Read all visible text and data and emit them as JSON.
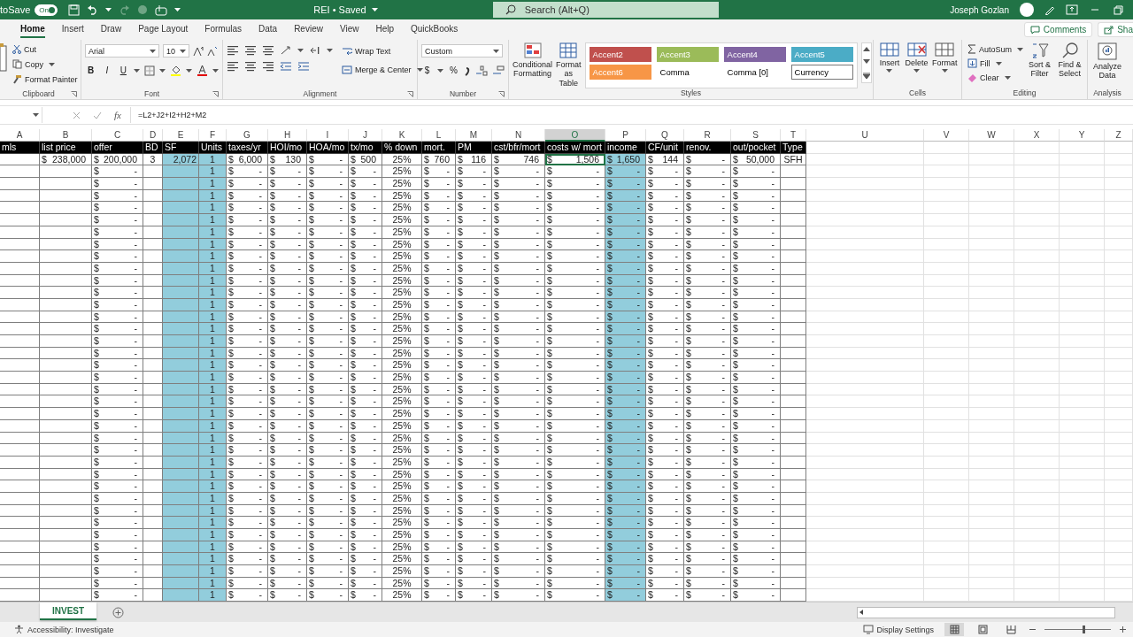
{
  "title_bar": {
    "autosave": "toSave",
    "autosave_toggle": {
      "label": "On",
      "on": true
    },
    "title": "REI • Saved",
    "search": {
      "placeholder": "Search (Alt+Q)"
    },
    "user": "Joseph Gozlan"
  },
  "ribbon_tabs": [
    {
      "label": "Home",
      "selected": true
    },
    {
      "label": "Insert",
      "selected": false
    },
    {
      "label": "Draw",
      "selected": false
    },
    {
      "label": "Page Layout",
      "selected": false
    },
    {
      "label": "Formulas",
      "selected": false
    },
    {
      "label": "Data",
      "selected": false
    },
    {
      "label": "Review",
      "selected": false
    },
    {
      "label": "View",
      "selected": false
    },
    {
      "label": "Help",
      "selected": false
    },
    {
      "label": "QuickBooks",
      "selected": false
    }
  ],
  "comments": "Comments",
  "share": "Sha",
  "ribbon": {
    "clipboard": {
      "cut": "Cut",
      "copy": "Copy",
      "format_painter": "Format Painter",
      "label": "Clipboard"
    },
    "font": {
      "family": "Arial",
      "size": "10",
      "bold": "B",
      "italic": "I",
      "underline": "U",
      "label": "Font"
    },
    "alignment": {
      "wrap_text": "Wrap Text",
      "merge_center": "Merge & Center",
      "label": "Alignment"
    },
    "number": {
      "format": "Custom",
      "currency": "$",
      "percent": "%",
      "label": "Number"
    },
    "styles": {
      "conditional_formatting": "Conditional Formatting",
      "format_as_table": "Format as Table",
      "label": "Styles",
      "cell_styles": [
        {
          "label": "Accent2",
          "color": "#c0504d",
          "selected": false
        },
        {
          "label": "Accent3",
          "color": "#9bbb59",
          "selected": false
        },
        {
          "label": "Accent4",
          "color": "#8064a2",
          "selected": false
        },
        {
          "label": "Accent5",
          "color": "#4bacc6",
          "selected": false
        },
        {
          "label": "Accent6",
          "color": "#f79646",
          "selected": false
        },
        {
          "label": "Comma",
          "selected": false
        },
        {
          "label": "Comma [0]",
          "selected": false
        },
        {
          "label": "Currency",
          "selected": true
        }
      ]
    },
    "cells": {
      "insert": "Insert",
      "delete": "Delete",
      "format": "Format",
      "label": "Cells"
    },
    "editing": {
      "autosum": "AutoSum",
      "fill": "Fill",
      "clear": "Clear",
      "sort_filter": "Sort & Filter",
      "find_select": "Find & Select",
      "label": "Editing"
    },
    "analysis": {
      "analyze_data": "Analyze Data",
      "label": "Analysis"
    }
  },
  "formula_bar": {
    "fx": "fx",
    "formula": "=L2+J2+I2+H2+M2"
  },
  "sheet": {
    "columns": [
      {
        "letter": "A",
        "highlighted": false,
        "selected": false
      },
      {
        "letter": "B",
        "highlighted": false,
        "selected": false
      },
      {
        "letter": "C",
        "highlighted": false,
        "selected": false
      },
      {
        "letter": "D",
        "highlighted": false,
        "selected": false
      },
      {
        "letter": "E",
        "highlighted": true,
        "selected": false
      },
      {
        "letter": "F",
        "highlighted": true,
        "selected": false
      },
      {
        "letter": "G",
        "highlighted": false,
        "selected": false
      },
      {
        "letter": "H",
        "highlighted": false,
        "selected": false
      },
      {
        "letter": "I",
        "highlighted": false,
        "selected": false
      },
      {
        "letter": "J",
        "highlighted": false,
        "selected": false
      },
      {
        "letter": "K",
        "highlighted": false,
        "selected": false
      },
      {
        "letter": "L",
        "highlighted": false,
        "selected": false
      },
      {
        "letter": "M",
        "highlighted": false,
        "selected": false
      },
      {
        "letter": "N",
        "highlighted": false,
        "selected": false
      },
      {
        "letter": "O",
        "highlighted": false,
        "selected": true
      },
      {
        "letter": "P",
        "highlighted": true,
        "selected": false
      },
      {
        "letter": "Q",
        "highlighted": false,
        "selected": false
      },
      {
        "letter": "R",
        "highlighted": false,
        "selected": false
      },
      {
        "letter": "S",
        "highlighted": false,
        "selected": false
      },
      {
        "letter": "T",
        "highlighted": false,
        "selected": false
      },
      {
        "letter": "U",
        "highlighted": false,
        "selected": false
      },
      {
        "letter": "V",
        "highlighted": false,
        "selected": false
      },
      {
        "letter": "W",
        "highlighted": false,
        "selected": false
      },
      {
        "letter": "X",
        "highlighted": false,
        "selected": false
      },
      {
        "letter": "Y",
        "highlighted": false,
        "selected": false
      },
      {
        "letter": "Z",
        "highlighted": false,
        "selected": false
      }
    ],
    "rows": [
      {
        "kind": "header",
        "selected": false,
        "cells": [
          "mls",
          "list price",
          "offer",
          "BD",
          "SF",
          "Units",
          "taxes/yr",
          "HOI/mo",
          "HOA/mo",
          "tx/mo",
          "% down",
          "mort.",
          "PM",
          "cst/bfr/mort",
          "costs w/ mort",
          "income",
          "CF/unit",
          "renov.",
          "out/pocket",
          "Type"
        ]
      },
      {
        "kind": "data",
        "selected": true,
        "cells": [
          null,
          "$ 238,000",
          "$ 200,000",
          "3",
          "2,072",
          "1",
          "$ 6,000",
          "$ 130",
          "$ -",
          "$ 500",
          "25%",
          "$ 760",
          "$ 116",
          "$ 746",
          "$ 1,506",
          "$ 1,650",
          "$ 144",
          "$ -",
          "$ 50,000",
          "SFH"
        ]
      },
      {
        "kind": "data",
        "selected": false,
        "cells": [
          null,
          null,
          "$ -",
          null,
          null,
          "1",
          "$ -",
          "$ -",
          "$ -",
          "$ -",
          "25%",
          "$ -",
          "$ -",
          "$ -",
          "$ -",
          "$ -",
          "$ -",
          "$ -",
          "$ -",
          null
        ]
      },
      {
        "kind": "data",
        "selected": false,
        "cells": [
          null,
          null,
          "$ -",
          null,
          null,
          "1",
          "$ -",
          "$ -",
          "$ -",
          "$ -",
          "25%",
          "$ -",
          "$ -",
          "$ -",
          "$ -",
          "$ -",
          "$ -",
          "$ -",
          "$ -",
          null
        ]
      },
      {
        "kind": "data",
        "selected": false,
        "cells": [
          null,
          null,
          "$ -",
          null,
          null,
          "1",
          "$ -",
          "$ -",
          "$ -",
          "$ -",
          "25%",
          "$ -",
          "$ -",
          "$ -",
          "$ -",
          "$ -",
          "$ -",
          "$ -",
          "$ -",
          null
        ]
      },
      {
        "kind": "data",
        "selected": false,
        "cells": [
          null,
          null,
          "$ -",
          null,
          null,
          "1",
          "$ -",
          "$ -",
          "$ -",
          "$ -",
          "25%",
          "$ -",
          "$ -",
          "$ -",
          "$ -",
          "$ -",
          "$ -",
          "$ -",
          "$ -",
          null
        ]
      },
      {
        "kind": "data",
        "selected": false,
        "cells": [
          null,
          null,
          "$ -",
          null,
          null,
          "1",
          "$ -",
          "$ -",
          "$ -",
          "$ -",
          "25%",
          "$ -",
          "$ -",
          "$ -",
          "$ -",
          "$ -",
          "$ -",
          "$ -",
          "$ -",
          null
        ]
      },
      {
        "kind": "data",
        "selected": false,
        "cells": [
          null,
          null,
          "$ -",
          null,
          null,
          "1",
          "$ -",
          "$ -",
          "$ -",
          "$ -",
          "25%",
          "$ -",
          "$ -",
          "$ -",
          "$ -",
          "$ -",
          "$ -",
          "$ -",
          "$ -",
          null
        ]
      },
      {
        "kind": "data",
        "selected": false,
        "cells": [
          null,
          null,
          "$ -",
          null,
          null,
          "1",
          "$ -",
          "$ -",
          "$ -",
          "$ -",
          "25%",
          "$ -",
          "$ -",
          "$ -",
          "$ -",
          "$ -",
          "$ -",
          "$ -",
          "$ -",
          null
        ]
      },
      {
        "kind": "data",
        "selected": false,
        "cells": [
          null,
          null,
          "$ -",
          null,
          null,
          "1",
          "$ -",
          "$ -",
          "$ -",
          "$ -",
          "25%",
          "$ -",
          "$ -",
          "$ -",
          "$ -",
          "$ -",
          "$ -",
          "$ -",
          "$ -",
          null
        ]
      },
      {
        "kind": "data",
        "selected": false,
        "cells": [
          null,
          null,
          "$ -",
          null,
          null,
          "1",
          "$ -",
          "$ -",
          "$ -",
          "$ -",
          "25%",
          "$ -",
          "$ -",
          "$ -",
          "$ -",
          "$ -",
          "$ -",
          "$ -",
          "$ -",
          null
        ]
      },
      {
        "kind": "data",
        "selected": false,
        "cells": [
          null,
          null,
          "$ -",
          null,
          null,
          "1",
          "$ -",
          "$ -",
          "$ -",
          "$ -",
          "25%",
          "$ -",
          "$ -",
          "$ -",
          "$ -",
          "$ -",
          "$ -",
          "$ -",
          "$ -",
          null
        ]
      },
      {
        "kind": "data",
        "selected": false,
        "cells": [
          null,
          null,
          "$ -",
          null,
          null,
          "1",
          "$ -",
          "$ -",
          "$ -",
          "$ -",
          "25%",
          "$ -",
          "$ -",
          "$ -",
          "$ -",
          "$ -",
          "$ -",
          "$ -",
          "$ -",
          null
        ]
      },
      {
        "kind": "data",
        "selected": false,
        "cells": [
          null,
          null,
          "$ -",
          null,
          null,
          "1",
          "$ -",
          "$ -",
          "$ -",
          "$ -",
          "25%",
          "$ -",
          "$ -",
          "$ -",
          "$ -",
          "$ -",
          "$ -",
          "$ -",
          "$ -",
          null
        ]
      },
      {
        "kind": "data",
        "selected": false,
        "cells": [
          null,
          null,
          "$ -",
          null,
          null,
          "1",
          "$ -",
          "$ -",
          "$ -",
          "$ -",
          "25%",
          "$ -",
          "$ -",
          "$ -",
          "$ -",
          "$ -",
          "$ -",
          "$ -",
          "$ -",
          null
        ]
      },
      {
        "kind": "data",
        "selected": false,
        "cells": [
          null,
          null,
          "$ -",
          null,
          null,
          "1",
          "$ -",
          "$ -",
          "$ -",
          "$ -",
          "25%",
          "$ -",
          "$ -",
          "$ -",
          "$ -",
          "$ -",
          "$ -",
          "$ -",
          "$ -",
          null
        ]
      },
      {
        "kind": "data",
        "selected": false,
        "cells": [
          null,
          null,
          "$ -",
          null,
          null,
          "1",
          "$ -",
          "$ -",
          "$ -",
          "$ -",
          "25%",
          "$ -",
          "$ -",
          "$ -",
          "$ -",
          "$ -",
          "$ -",
          "$ -",
          "$ -",
          null
        ]
      },
      {
        "kind": "data",
        "selected": false,
        "cells": [
          null,
          null,
          "$ -",
          null,
          null,
          "1",
          "$ -",
          "$ -",
          "$ -",
          "$ -",
          "25%",
          "$ -",
          "$ -",
          "$ -",
          "$ -",
          "$ -",
          "$ -",
          "$ -",
          "$ -",
          null
        ]
      },
      {
        "kind": "data",
        "selected": false,
        "cells": [
          null,
          null,
          "$ -",
          null,
          null,
          "1",
          "$ -",
          "$ -",
          "$ -",
          "$ -",
          "25%",
          "$ -",
          "$ -",
          "$ -",
          "$ -",
          "$ -",
          "$ -",
          "$ -",
          "$ -",
          null
        ]
      },
      {
        "kind": "data",
        "selected": false,
        "cells": [
          null,
          null,
          "$ -",
          null,
          null,
          "1",
          "$ -",
          "$ -",
          "$ -",
          "$ -",
          "25%",
          "$ -",
          "$ -",
          "$ -",
          "$ -",
          "$ -",
          "$ -",
          "$ -",
          "$ -",
          null
        ]
      },
      {
        "kind": "data",
        "selected": false,
        "cells": [
          null,
          null,
          "$ -",
          null,
          null,
          "1",
          "$ -",
          "$ -",
          "$ -",
          "$ -",
          "25%",
          "$ -",
          "$ -",
          "$ -",
          "$ -",
          "$ -",
          "$ -",
          "$ -",
          "$ -",
          null
        ]
      },
      {
        "kind": "data",
        "selected": false,
        "cells": [
          null,
          null,
          "$ -",
          null,
          null,
          "1",
          "$ -",
          "$ -",
          "$ -",
          "$ -",
          "25%",
          "$ -",
          "$ -",
          "$ -",
          "$ -",
          "$ -",
          "$ -",
          "$ -",
          "$ -",
          null
        ]
      },
      {
        "kind": "data",
        "selected": false,
        "cells": [
          null,
          null,
          "$ -",
          null,
          null,
          "1",
          "$ -",
          "$ -",
          "$ -",
          "$ -",
          "25%",
          "$ -",
          "$ -",
          "$ -",
          "$ -",
          "$ -",
          "$ -",
          "$ -",
          "$ -",
          null
        ]
      },
      {
        "kind": "data",
        "selected": false,
        "cells": [
          null,
          null,
          "$ -",
          null,
          null,
          "1",
          "$ -",
          "$ -",
          "$ -",
          "$ -",
          "25%",
          "$ -",
          "$ -",
          "$ -",
          "$ -",
          "$ -",
          "$ -",
          "$ -",
          "$ -",
          null
        ]
      },
      {
        "kind": "data",
        "selected": false,
        "cells": [
          null,
          null,
          "$ -",
          null,
          null,
          "1",
          "$ -",
          "$ -",
          "$ -",
          "$ -",
          "25%",
          "$ -",
          "$ -",
          "$ -",
          "$ -",
          "$ -",
          "$ -",
          "$ -",
          "$ -",
          null
        ]
      },
      {
        "kind": "data",
        "selected": false,
        "cells": [
          null,
          null,
          "$ -",
          null,
          null,
          "1",
          "$ -",
          "$ -",
          "$ -",
          "$ -",
          "25%",
          "$ -",
          "$ -",
          "$ -",
          "$ -",
          "$ -",
          "$ -",
          "$ -",
          "$ -",
          null
        ]
      },
      {
        "kind": "data",
        "selected": false,
        "cells": [
          null,
          null,
          "$ -",
          null,
          null,
          "1",
          "$ -",
          "$ -",
          "$ -",
          "$ -",
          "25%",
          "$ -",
          "$ -",
          "$ -",
          "$ -",
          "$ -",
          "$ -",
          "$ -",
          "$ -",
          null
        ]
      },
      {
        "kind": "data",
        "selected": false,
        "cells": [
          null,
          null,
          "$ -",
          null,
          null,
          "1",
          "$ -",
          "$ -",
          "$ -",
          "$ -",
          "25%",
          "$ -",
          "$ -",
          "$ -",
          "$ -",
          "$ -",
          "$ -",
          "$ -",
          "$ -",
          null
        ]
      },
      {
        "kind": "data",
        "selected": false,
        "cells": [
          null,
          null,
          "$ -",
          null,
          null,
          "1",
          "$ -",
          "$ -",
          "$ -",
          "$ -",
          "25%",
          "$ -",
          "$ -",
          "$ -",
          "$ -",
          "$ -",
          "$ -",
          "$ -",
          "$ -",
          null
        ]
      },
      {
        "kind": "data",
        "selected": false,
        "cells": [
          null,
          null,
          "$ -",
          null,
          null,
          "1",
          "$ -",
          "$ -",
          "$ -",
          "$ -",
          "25%",
          "$ -",
          "$ -",
          "$ -",
          "$ -",
          "$ -",
          "$ -",
          "$ -",
          "$ -",
          null
        ]
      },
      {
        "kind": "data",
        "selected": false,
        "cells": [
          null,
          null,
          "$ -",
          null,
          null,
          "1",
          "$ -",
          "$ -",
          "$ -",
          "$ -",
          "25%",
          "$ -",
          "$ -",
          "$ -",
          "$ -",
          "$ -",
          "$ -",
          "$ -",
          "$ -",
          null
        ]
      },
      {
        "kind": "data",
        "selected": false,
        "cells": [
          null,
          null,
          "$ -",
          null,
          null,
          "1",
          "$ -",
          "$ -",
          "$ -",
          "$ -",
          "25%",
          "$ -",
          "$ -",
          "$ -",
          "$ -",
          "$ -",
          "$ -",
          "$ -",
          "$ -",
          null
        ]
      },
      {
        "kind": "data",
        "selected": false,
        "cells": [
          null,
          null,
          "$ -",
          null,
          null,
          "1",
          "$ -",
          "$ -",
          "$ -",
          "$ -",
          "25%",
          "$ -",
          "$ -",
          "$ -",
          "$ -",
          "$ -",
          "$ -",
          "$ -",
          "$ -",
          null
        ]
      },
      {
        "kind": "data",
        "selected": false,
        "cells": [
          null,
          null,
          "$ -",
          null,
          null,
          "1",
          "$ -",
          "$ -",
          "$ -",
          "$ -",
          "25%",
          "$ -",
          "$ -",
          "$ -",
          "$ -",
          "$ -",
          "$ -",
          "$ -",
          "$ -",
          null
        ]
      },
      {
        "kind": "data",
        "selected": false,
        "cells": [
          null,
          null,
          "$ -",
          null,
          null,
          "1",
          "$ -",
          "$ -",
          "$ -",
          "$ -",
          "25%",
          "$ -",
          "$ -",
          "$ -",
          "$ -",
          "$ -",
          "$ -",
          "$ -",
          "$ -",
          null
        ]
      },
      {
        "kind": "data",
        "selected": false,
        "cells": [
          null,
          null,
          "$ -",
          null,
          null,
          "1",
          "$ -",
          "$ -",
          "$ -",
          "$ -",
          "25%",
          "$ -",
          "$ -",
          "$ -",
          "$ -",
          "$ -",
          "$ -",
          "$ -",
          "$ -",
          null
        ]
      },
      {
        "kind": "data",
        "selected": false,
        "cells": [
          null,
          null,
          "$ -",
          null,
          null,
          "1",
          "$ -",
          "$ -",
          "$ -",
          "$ -",
          "25%",
          "$ -",
          "$ -",
          "$ -",
          "$ -",
          "$ -",
          "$ -",
          "$ -",
          "$ -",
          null
        ]
      },
      {
        "kind": "data",
        "selected": false,
        "cells": [
          null,
          null,
          "$ -",
          null,
          null,
          "1",
          "$ -",
          "$ -",
          "$ -",
          "$ -",
          "25%",
          "$ -",
          "$ -",
          "$ -",
          "$ -",
          "$ -",
          "$ -",
          "$ -",
          "$ -",
          null
        ]
      }
    ]
  },
  "sheet_tabs": [
    {
      "label": "INVEST",
      "selected": true
    }
  ],
  "status_bar": {
    "accessibility": "Accessibility: Investigate",
    "display_settings": "Display Settings",
    "zoom": {
      "level": 0.6
    }
  }
}
